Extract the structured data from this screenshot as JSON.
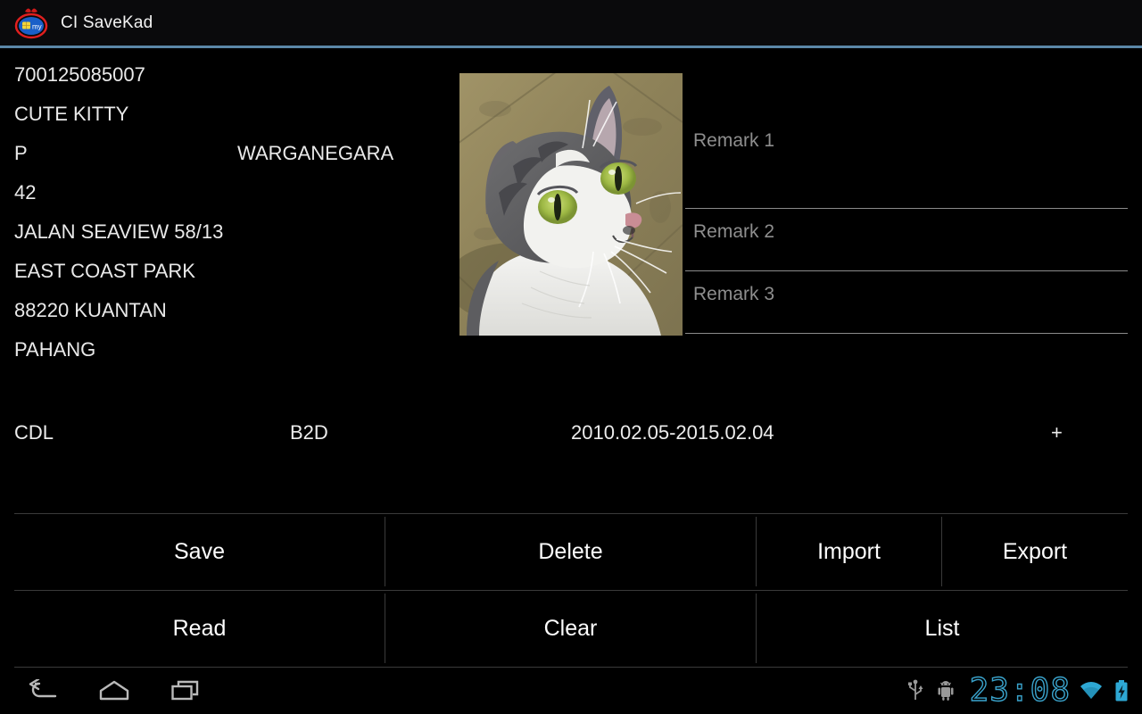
{
  "titlebar": {
    "app_name": "CI SaveKad",
    "icon": "mykad-logo-icon",
    "accent_color": "#5b87a8"
  },
  "card": {
    "id_number": "700125085007",
    "name": "CUTE KITTY",
    "gender": "P",
    "citizenship": "WARGANEGARA",
    "address_line1": "42",
    "address_line2": "JALAN SEAVIEW 58/13",
    "address_line3": "EAST COAST PARK",
    "postcode_city": "88220  KUANTAN",
    "state": "PAHANG",
    "photo_alt": "cat-photo"
  },
  "remarks": [
    {
      "placeholder": "Remark 1",
      "value": ""
    },
    {
      "placeholder": "Remark 2",
      "value": ""
    },
    {
      "placeholder": "Remark 3",
      "value": ""
    }
  ],
  "license": {
    "label": "CDL",
    "class": "B2D",
    "validity": "2010.02.05-2015.02.04",
    "add": "+"
  },
  "buttons": {
    "save": "Save",
    "delete": "Delete",
    "import": "Import",
    "export": "Export",
    "read": "Read",
    "clear": "Clear",
    "list": "List"
  },
  "navbar": {
    "back": "back-icon",
    "home": "home-icon",
    "recents": "recents-icon"
  },
  "statusbar": {
    "usb": "usb-icon",
    "adb": "android-debug-icon",
    "time": "23:08",
    "wifi": "wifi-icon",
    "battery": "battery-charging-icon",
    "clock_color": "#3aa3cc"
  }
}
